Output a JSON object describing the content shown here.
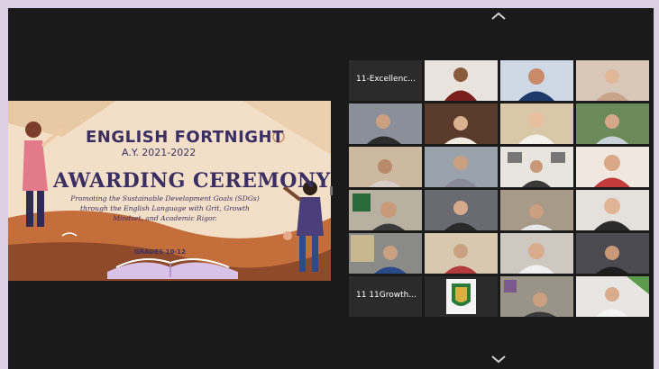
{
  "shared_screen": {
    "title": "ENGLISH FORTNIGHT",
    "academic_year": "A.Y. 2021-2022",
    "event": "AWARDING CEREMONY",
    "theme_line1": "Promoting the Sustainable Development Goals (SDGs)",
    "theme_line2": "through the English Language with Grit, Growth",
    "theme_line3": "Mindset, and Academic Rigor.",
    "grades": "GRADES 10-12"
  },
  "gallery": {
    "label_tiles": [
      "11-Excellenc...",
      "11 11Growth..."
    ],
    "scroll_up": "chevron-up-icon",
    "scroll_down": "chevron-down-icon"
  },
  "colors": {
    "window_bg": "#1a1a1a",
    "page_bg": "#dccfe3",
    "slide_accent": "#3a2f63",
    "slide_bg": "#f3dfc7"
  }
}
